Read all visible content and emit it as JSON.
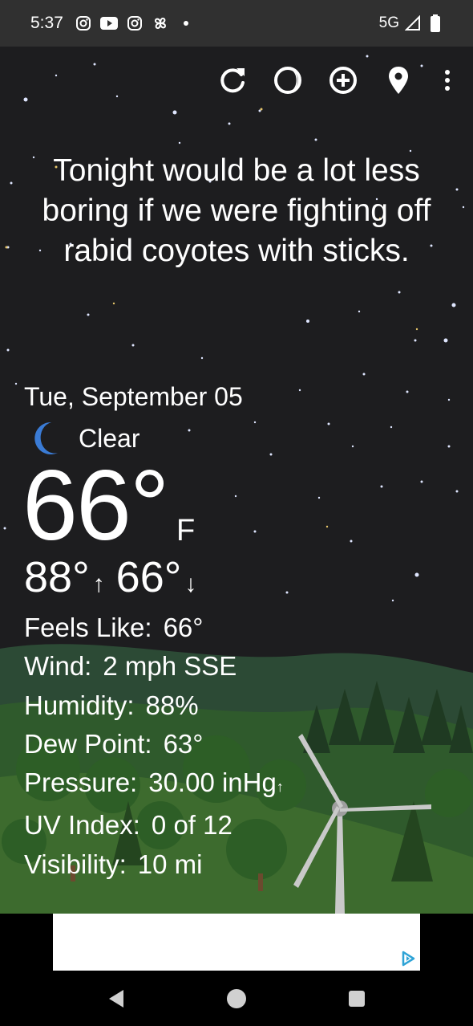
{
  "status_bar": {
    "time": "5:37",
    "network": "5G",
    "left_icons": [
      "instagram-icon",
      "youtube-icon",
      "instagram-icon",
      "pinwheel-icon",
      "dot-icon"
    ],
    "right_icons": [
      "signal-icon",
      "battery-icon"
    ]
  },
  "toolbar": {
    "icons": [
      "refresh-icon",
      "moon-phase-icon",
      "add-location-icon",
      "location-pin-icon",
      "more-vert-icon"
    ]
  },
  "quote": "Tonight would be a lot less boring if we were fighting off rabid coyotes with sticks.",
  "weather": {
    "date": "Tue, September 05",
    "condition": "Clear",
    "condition_icon": "moon-crescent-icon",
    "temp": "66°",
    "unit": "F",
    "high": "88°",
    "low": "66°"
  },
  "details": [
    {
      "label": "Feels Like:",
      "value": "66°"
    },
    {
      "label": "Wind:",
      "value": "2 mph SSE"
    },
    {
      "label": "Humidity:",
      "value": "88%"
    },
    {
      "label": "Dew Point:",
      "value": "63°"
    },
    {
      "label": "Pressure:",
      "value": "30.00 inHg"
    },
    {
      "label": "UV Index:",
      "value": "0 of 12"
    },
    {
      "label": "Visibility:",
      "value": "10 mi"
    }
  ],
  "ad": {
    "icon": "ad-choices-icon"
  },
  "navbar": {
    "icons": [
      "back-icon",
      "home-icon",
      "recents-icon"
    ]
  },
  "colors": {
    "status_bar_bg": "#303030",
    "sky_bg": "#1d1d1f",
    "moon_icon": "#3a7bd5",
    "hills": "#3d6b2e"
  }
}
